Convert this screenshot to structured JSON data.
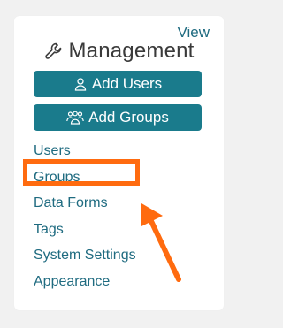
{
  "panel": {
    "view_link": "View",
    "title": "Management",
    "title_icon": "wrench-icon"
  },
  "buttons": {
    "add_users": {
      "label": "Add Users",
      "icon": "user-icon"
    },
    "add_groups": {
      "label": "Add Groups",
      "icon": "group-icon"
    }
  },
  "nav": {
    "items": [
      {
        "label": "Users"
      },
      {
        "label": "Groups"
      },
      {
        "label": "Data Forms"
      },
      {
        "label": "Tags"
      },
      {
        "label": "System Settings"
      },
      {
        "label": "Appearance"
      }
    ]
  },
  "annotation": {
    "highlighted_item": "Groups",
    "color": "#ff6b0f"
  },
  "colors": {
    "accent": "#1a7b8c",
    "link": "#1f6b80",
    "background": "#f1f1f1",
    "card": "#ffffff"
  }
}
